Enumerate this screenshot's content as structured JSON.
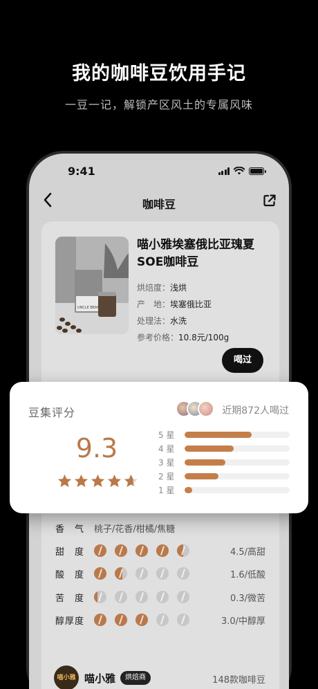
{
  "hero": {
    "title": "我的咖啡豆饮用手记",
    "subtitle": "一豆一记，解锁产区风土的专属风味"
  },
  "status_bar": {
    "time": "9:41"
  },
  "nav": {
    "title": "咖啡豆",
    "back_icon": "chevron-left-icon",
    "share_icon": "share-icon"
  },
  "bean": {
    "name": "喵小雅埃塞俄比亚瑰夏SOE咖啡豆",
    "image_label": "UNCLE BEAN",
    "info": [
      {
        "key": "烘焙度：",
        "value": "浅烘"
      },
      {
        "key": "产　地：",
        "value": "埃塞俄比亚"
      },
      {
        "key": "处理法：",
        "value": "水洗"
      },
      {
        "key": "参考价格：",
        "value": "10.8元/100g"
      }
    ],
    "drink_button": "喝过"
  },
  "rating": {
    "label": "豆集评分",
    "drank_count": "近期872人喝过",
    "score": "9.3",
    "stars_value": 4.65,
    "distribution": [
      {
        "label": "5 星",
        "value": 0.64
      },
      {
        "label": "4 星",
        "value": 0.47
      },
      {
        "label": "3 星",
        "value": 0.39
      },
      {
        "label": "2 星",
        "value": 0.32
      },
      {
        "label": "1 星",
        "value": 0.07
      }
    ],
    "accent_color": "#b9794b"
  },
  "flavor": {
    "aroma_label": "香　气",
    "aroma_value": "桃子/花香/柑橘/焦糖",
    "rows": [
      {
        "label": "甜　度",
        "value": 4.5,
        "text": "4.5/高甜"
      },
      {
        "label": "酸　度",
        "value": 1.6,
        "text": "1.6/低酸"
      },
      {
        "label": "苦　度",
        "value": 0.3,
        "text": "0.3/微苦"
      },
      {
        "label": "醇厚度",
        "value": 3.0,
        "text": "3.0/中醇厚"
      }
    ]
  },
  "roaster": {
    "logo_text": "喵小雅",
    "name": "喵小雅",
    "badge": "烘焙商",
    "count": "148款咖啡豆"
  }
}
